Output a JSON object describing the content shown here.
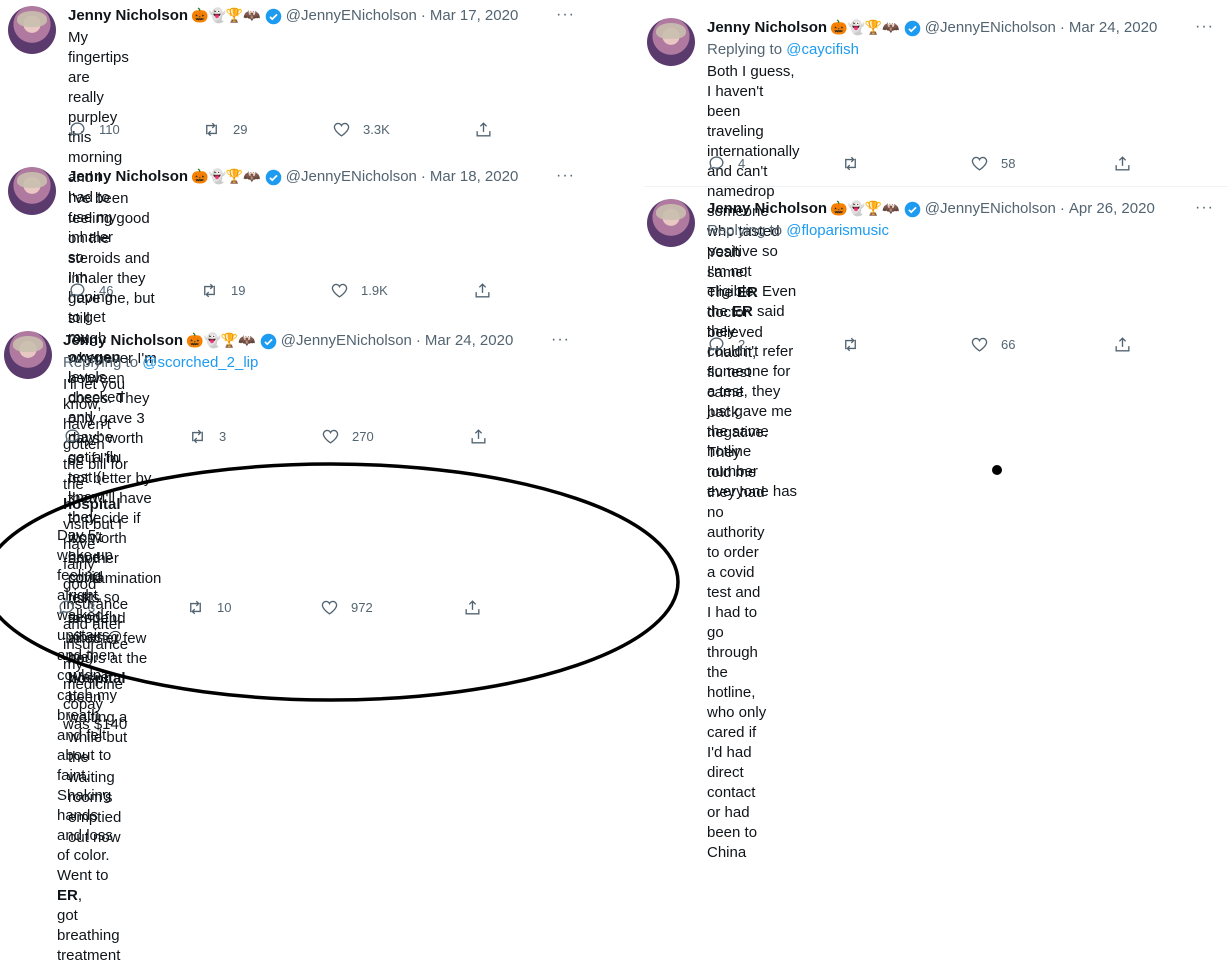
{
  "colors": {
    "accent": "#1d9bf0",
    "secondary_text": "#536471",
    "text": "#0f1419",
    "annotation": "#000000"
  },
  "author": {
    "name": "Jenny Nicholson",
    "badges": "🎃👻🏆🦇",
    "handle": "@JennyENicholson",
    "separator": "·"
  },
  "more_icon": "···",
  "tweets": [
    {
      "date": "Mar 17, 2020",
      "text_parts": [
        "My fingertips are really purpley this morning and I had to use my inhaler so\nI'm hoping to get my ",
        "oxygen",
        " levels checked and maybe get a flu test (I\nknow they won't have covid tests so send flu vibes @ me). We've been\nwaiting a while but the waiting room's emptied out now"
      ],
      "replies": "110",
      "retweets": "29",
      "likes": "3.3K"
    },
    {
      "date": "Mar 18, 2020",
      "text_parts": [
        "I've been feeling good on the steroids and inhaler they gave me, but still\nrough whenever I'm between doses. They only gave 3 days' worth so if I'm\nnot better by then I'll have to decide if it's worth another contamination risk\nto spend another few hours at the ",
        "hospital",
        ""
      ],
      "replies": "46",
      "retweets": "19",
      "likes": "1.9K"
    },
    {
      "date": "Mar 24, 2020",
      "replying_label": "Replying to ",
      "replying_to": "@scorched_2_lip",
      "text_parts": [
        "I'll let you know, haven't gotten the bill for the ",
        "hospital",
        " visit but I have fairly\ngood insurance and after insurance my medicine copay was $140"
      ],
      "replies": "",
      "retweets": "3",
      "likes": "270"
    },
    {
      "text_parts": [
        "Day 5: woke up feeling alright, walked upstairs and then couldn't catch my\nbreath and felt about to faint. Shaking hands and loss of color. Went to ",
        "ER",
        ",\ngot breathing treatment"
      ],
      "replies": "3",
      "retweets": "10",
      "likes": "972"
    },
    {
      "date": "Mar 24, 2020",
      "replying_label": "Replying to ",
      "replying_to": "@caycifish",
      "text_parts": [
        "Both I guess, I haven't been traveling internationally and can't namedrop\nsomeone who tasted positive so I'm not eligible. Even the ",
        "ER",
        " said they\ncouldn't refer someone for a test, they just gave me the same hotline\nnumber everyone has"
      ],
      "replies": "4",
      "retweets": "",
      "likes": "58"
    },
    {
      "date": "Apr 26, 2020",
      "replying_label": "Replying to ",
      "replying_to": "@floparismusic",
      "text_parts": [
        "Yeah same! The ",
        "ER",
        " doctor believed I had it, flu test came back negative.\nThey told me they had no authority to order a covid test and I had to go\nthrough the hotline, who only cared if I'd had direct contact or had been to\nChina"
      ],
      "replies": "2",
      "retweets": "",
      "likes": "66"
    }
  ]
}
